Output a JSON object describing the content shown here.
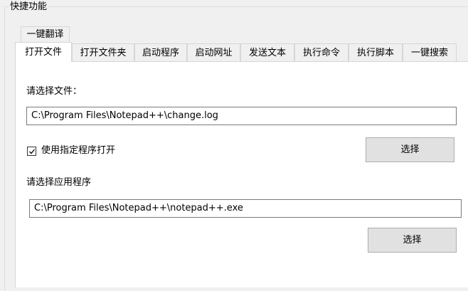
{
  "group": {
    "title": "快捷功能"
  },
  "tabs": {
    "back_row": [
      "一键翻译"
    ],
    "front_row": [
      "打开文件",
      "打开文件夹",
      "启动程序",
      "启动网址",
      "发送文本",
      "执行命令",
      "执行脚本",
      "一键搜索"
    ],
    "active": "打开文件"
  },
  "open_file": {
    "file_label": "请选择文件：",
    "file_path": "C:\\Program Files\\Notepad++\\change.log",
    "use_program_label": "使用指定程序打开",
    "use_program_checked": true,
    "select_button_1": "选择",
    "app_label": "请选择应用程序",
    "app_path": "C:\\Program Files\\Notepad++\\notepad++.exe",
    "select_button_2": "选择"
  }
}
